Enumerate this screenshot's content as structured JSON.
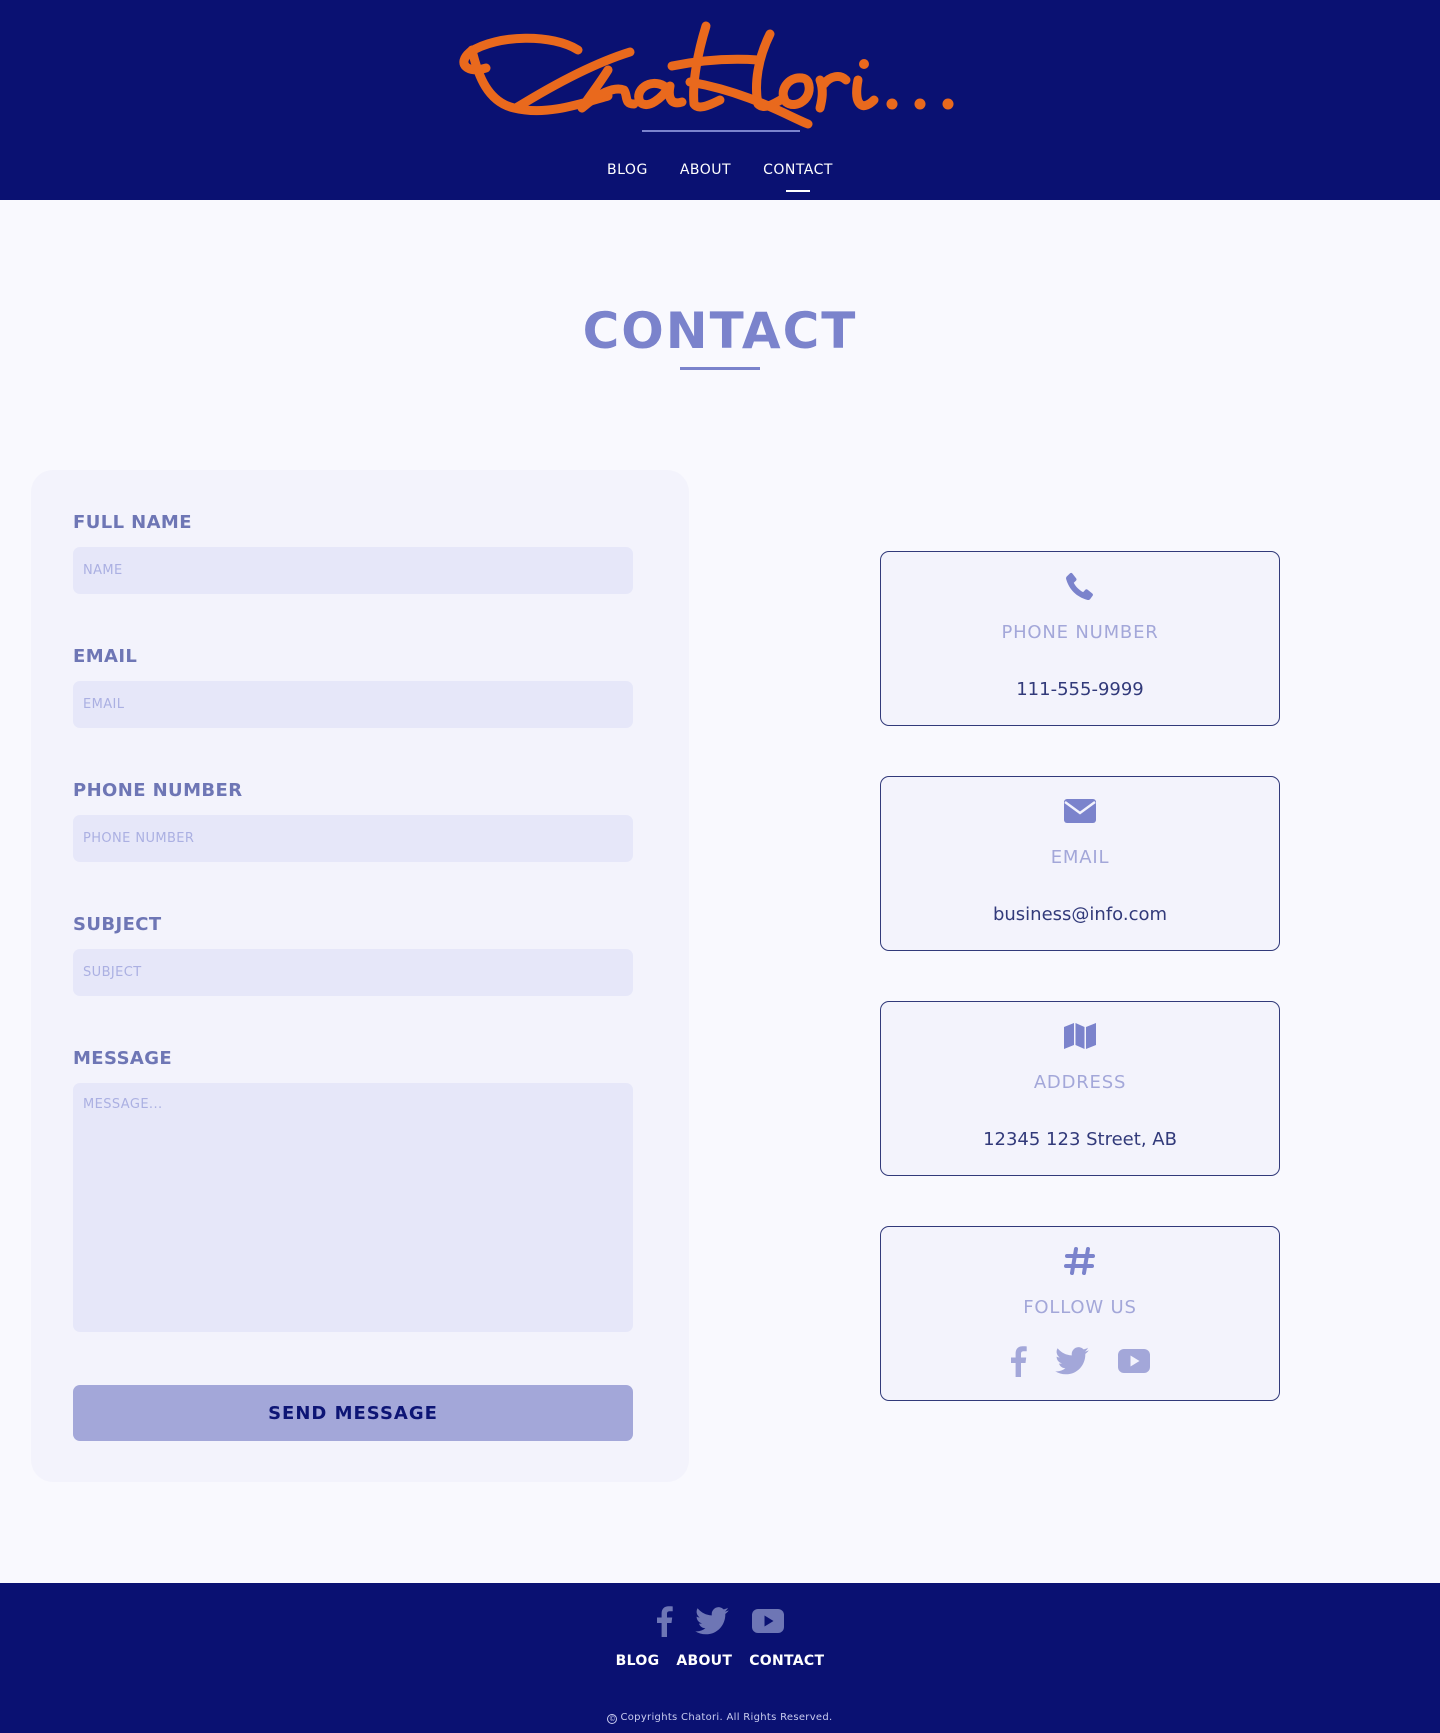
{
  "header": {
    "logo_text": "Chatori...",
    "logo_color": "#e9691d",
    "background": "#0a1172",
    "nav": [
      {
        "label": "BLOG",
        "active": false
      },
      {
        "label": "ABOUT",
        "active": false
      },
      {
        "label": "CONTACT",
        "active": true
      }
    ]
  },
  "page": {
    "title": "CONTACT",
    "accent": "#7b83cc"
  },
  "form": {
    "fields": [
      {
        "label": "FULL NAME",
        "placeholder": "NAME",
        "value": ""
      },
      {
        "label": "EMAIL",
        "placeholder": "EMAIL",
        "value": ""
      },
      {
        "label": "PHONE NUMBER",
        "placeholder": "PHONE NUMBER",
        "value": ""
      },
      {
        "label": "SUBJECT",
        "placeholder": "SUBJECT",
        "value": ""
      }
    ],
    "message": {
      "label": "MESSAGE",
      "placeholder": "MESSAGE...",
      "value": ""
    },
    "submit_label": "SEND MESSAGE"
  },
  "info_cards": [
    {
      "icon": "phone-icon",
      "title": "PHONE NUMBER",
      "value": "111-555-9999"
    },
    {
      "icon": "envelope-icon",
      "title": "EMAIL",
      "value": "business@info.com"
    },
    {
      "icon": "map-icon",
      "title": "ADDRESS",
      "value": "12345 123 Street, AB"
    },
    {
      "icon": "hashtag-icon",
      "title": "FOLLOW US",
      "social": [
        "facebook-icon",
        "twitter-icon",
        "youtube-icon"
      ]
    }
  ],
  "footer": {
    "social": [
      "facebook-icon",
      "twitter-icon",
      "youtube-icon"
    ],
    "nav": [
      {
        "label": "BLOG"
      },
      {
        "label": "ABOUT"
      },
      {
        "label": "CONTACT"
      }
    ],
    "copyright_symbol": "©",
    "copyright": "Copyrights Chatori. All Rights Reserved."
  }
}
